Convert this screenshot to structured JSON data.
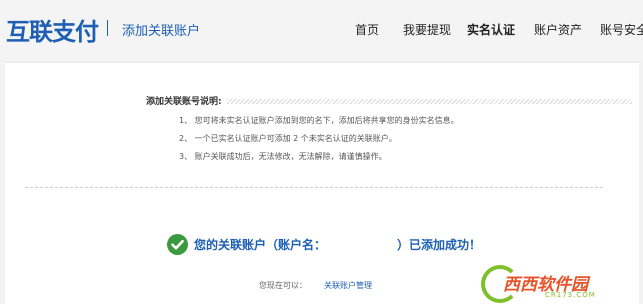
{
  "header": {
    "logo_text": "互联支付",
    "page_name": "添加关联账户",
    "nav": [
      "首页",
      "我要提现",
      "实名认证",
      "账户资产",
      "账号安全"
    ],
    "active_nav": "实名认证"
  },
  "instructions": {
    "title": "添加关联账号说明:",
    "items": [
      "1、 您可将未实名认证账户添加到您的名下，添加后将共享您的身份实名信息。",
      "2、 一个已实名认证账户可添加 2 个未实名认证的关联账户。",
      "3、 账户关联成功后，无法修改，无法解除，请谨慎操作。"
    ]
  },
  "success": {
    "message": "您的关联账户（账户名：",
    "suffix": "）已添加成功！",
    "status_color": "#3a9b3e"
  },
  "footer": {
    "can_now": "您现在可以：",
    "manage_link": "关联账户管理"
  },
  "watermark": {
    "text": "西西软件园",
    "sub": "CR173.COM"
  },
  "colors": {
    "brand": "#1d5fb4",
    "watermark_orange": "#e8542a",
    "watermark_green": "#7fbf2a"
  }
}
